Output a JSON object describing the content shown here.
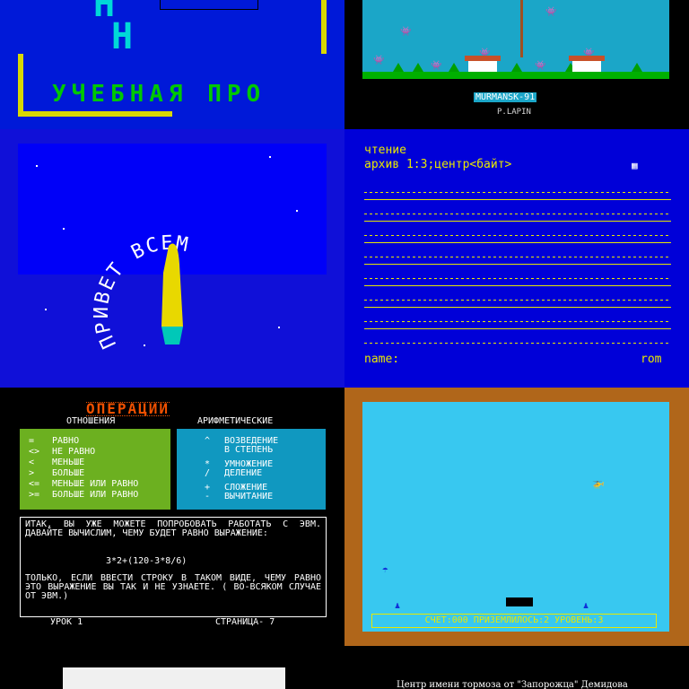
{
  "panel1": {
    "letters": [
      "Н",
      "Н"
    ],
    "title": "УЧЕБНАЯ ПРО"
  },
  "panel2": {
    "caption": "MURMANSK-91",
    "author": "P.LAPIN"
  },
  "panel3": {
    "greeting": "ПРИВЕТ ВСЕМ"
  },
  "panel4": {
    "line1": "чтение",
    "line2": "архив 1:3;центр<байт>",
    "footer_left": "name:",
    "footer_right": "rom"
  },
  "panel5": {
    "header": "ОПЕРАЦИИ",
    "col_left": "ОТНОШЕНИЯ",
    "col_right": "АРИФМЕТИЧЕСКИЕ",
    "relations": [
      {
        "op": "=",
        "text": "РАВНО"
      },
      {
        "op": "<>",
        "text": "НЕ РАВНО"
      },
      {
        "op": "<",
        "text": "МЕНЬШЕ"
      },
      {
        "op": ">",
        "text": "БОЛЬШЕ"
      },
      {
        "op": "<=",
        "text": "МЕНЬШЕ ИЛИ РАВНО"
      },
      {
        "op": ">=",
        "text": "БОЛЬШЕ ИЛИ РАВНО"
      }
    ],
    "arith": [
      {
        "op": "^",
        "text": "ВОЗВЕДЕНИЕ"
      },
      {
        "op": "",
        "text": "В СТЕПЕНЬ"
      },
      {
        "op": "*",
        "text": "УМНОЖЕНИЕ"
      },
      {
        "op": "/",
        "text": "ДЕЛЕНИЕ"
      },
      {
        "op": "+",
        "text": "СЛОЖЕНИЕ"
      },
      {
        "op": "-",
        "text": "ВЫЧИТАНИЕ"
      }
    ],
    "para1": "ИТАК, ВЫ УЖЕ МОЖЕТЕ ПОПРОБОВАТЬ РАБОТАТЬ С ЭВМ. ДАВАЙТЕ ВЫЧИСЛИМ, ЧЕМУ БУДЕТ РАВНО ВЫРАЖЕНИЕ:",
    "expression": "3*2+(120-3*8/6)",
    "para2": "ТОЛЬКО, ЕСЛИ ВВЕСТИ СТРОКУ В ТАКОМ ВИДЕ, ЧЕМУ РАВНО ЭТО ВЫРАЖЕНИЕ ВЫ ТАК И НЕ УЗНАЕТЕ. ( ВО-ВСЯКОМ СЛУЧАЕ ОТ ЭВМ.)",
    "lesson": "УРОК 1",
    "page": "СТРАНИЦА- 7"
  },
  "panel6": {
    "status": "СЧЕТ:000  ПРИЗЕМЛИЛОСЬ:2  УРОВЕНЬ:3"
  },
  "panel8": {
    "caption": "Центр имени тормоза от \"Запорожца\" Демидова"
  }
}
